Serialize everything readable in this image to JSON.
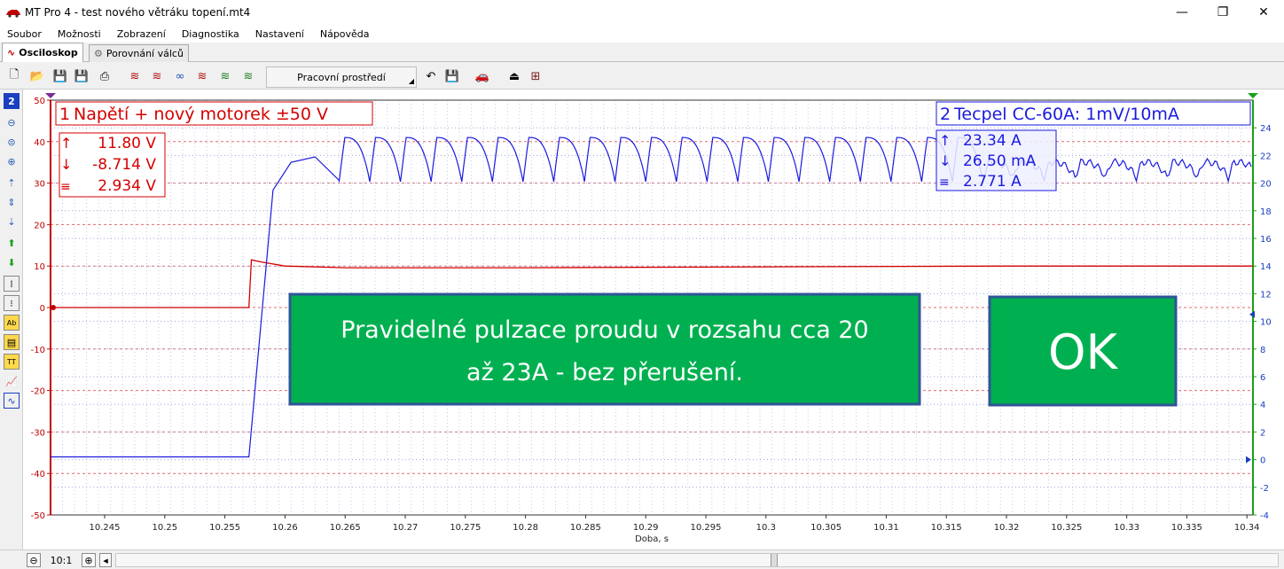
{
  "window": {
    "title": "MT Pro 4 - test nového větráku topení.mt4",
    "minimize": "—",
    "maximize": "❐",
    "close": "✕"
  },
  "menu": [
    "Soubor",
    "Možnosti",
    "Zobrazení",
    "Diagnostika",
    "Nastavení",
    "Nápověda"
  ],
  "tabs": [
    {
      "label": "Osciloskop",
      "icon": "wave-icon"
    },
    {
      "label": "Porovnání válců",
      "icon": "cylinder-icon"
    }
  ],
  "toolbar": {
    "workspace_label": "Pracovní prostředí"
  },
  "channel_badge": "2",
  "channels": {
    "ch1": {
      "number": "1",
      "label": "Napětí + nový motorek  ±50 V",
      "max": "11.80 V",
      "min": "-8.714 V",
      "avg": "2.934 V",
      "color": "#d40000"
    },
    "ch2": {
      "number": "2",
      "label": "Tecpel CC-60A: 1mV/10mA",
      "max": "23.34 A",
      "min": "26.50 mA",
      "avg": "2.771 A",
      "color": "#1a1adf"
    }
  },
  "annotations": {
    "note": "Pravidelné pulzace proudu v  rozsahu cca 20 až 23A - bez přerušení.",
    "ok": "OK",
    "box_fill": "#00b050",
    "box_border": "#2f5597"
  },
  "chart_data": {
    "type": "line",
    "xlabel": "Doba, s",
    "x_range": [
      10.2405,
      10.3405
    ],
    "x_ticks": [
      "10.245",
      "10.25",
      "10.255",
      "10.26",
      "10.265",
      "10.27",
      "10.275",
      "10.28",
      "10.285",
      "10.29",
      "10.295",
      "10.3",
      "10.305",
      "10.31",
      "10.315",
      "10.32",
      "10.325",
      "10.33",
      "10.335",
      "10.34"
    ],
    "y_left": {
      "range": [
        -50,
        50
      ],
      "ticks": [
        "50",
        "40",
        "30",
        "20",
        "10",
        "0",
        "-10",
        "-20",
        "-30",
        "-40",
        "-50"
      ]
    },
    "y_right": {
      "range": [
        -4,
        26
      ],
      "ticks": [
        "24",
        "22",
        "20",
        "18",
        "16",
        "14",
        "12",
        "10",
        "8",
        "6",
        "4",
        "2",
        "0",
        "-2",
        "-4"
      ]
    },
    "grid": true,
    "series": [
      {
        "name": "Napětí + nový motorek  ±50 V",
        "axis": "left",
        "x": [
          10.2405,
          10.257,
          10.2572,
          10.258,
          10.26,
          10.265,
          10.28,
          10.3,
          10.32,
          10.3405
        ],
        "y": [
          0,
          0,
          11.5,
          11.0,
          10.0,
          9.6,
          9.6,
          9.8,
          10.0,
          10.0
        ]
      },
      {
        "name": "Tecpel CC-60A: 1mV/10mA",
        "axis": "right",
        "pattern": "startup ramp then periodic pulsation between ~20.1 A and ~23.3 A",
        "x": [
          10.2405,
          10.257,
          10.259,
          10.2605,
          10.2625,
          10.2645,
          10.3405
        ],
        "y": [
          0.2,
          0.2,
          19.5,
          21.5,
          21.9,
          20.2,
          20.7
        ],
        "pulse_period": 0.00255,
        "pulse_min": 20.1,
        "pulse_max": 23.3
      }
    ]
  }
}
